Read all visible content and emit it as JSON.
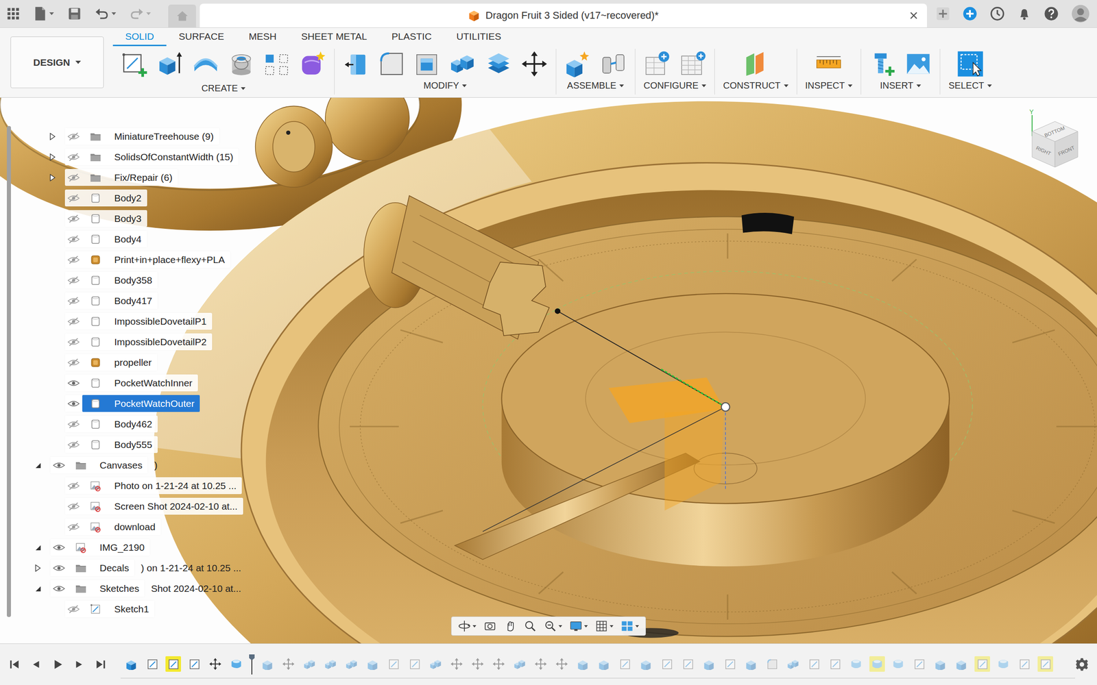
{
  "window": {
    "title": "Dragon Fruit 3 Sided (v17~recovered)*"
  },
  "workspace": {
    "label": "DESIGN"
  },
  "tabs": [
    {
      "label": "SOLID",
      "selected": true
    },
    {
      "label": "SURFACE",
      "selected": false
    },
    {
      "label": "MESH",
      "selected": false
    },
    {
      "label": "SHEET METAL",
      "selected": false
    },
    {
      "label": "PLASTIC",
      "selected": false
    },
    {
      "label": "UTILITIES",
      "selected": false
    }
  ],
  "tool_groups": [
    {
      "label": "CREATE",
      "tools": [
        {
          "kind": "sketch"
        },
        {
          "kind": "extrude"
        },
        {
          "kind": "revolve"
        },
        {
          "kind": "hole"
        },
        {
          "kind": "pattern"
        },
        {
          "kind": "form"
        }
      ]
    },
    {
      "label": "MODIFY",
      "tools": [
        {
          "kind": "presspull"
        },
        {
          "kind": "fillet"
        },
        {
          "kind": "shell"
        },
        {
          "kind": "combine"
        },
        {
          "kind": "offset"
        },
        {
          "kind": "move"
        }
      ]
    },
    {
      "label": "ASSEMBLE",
      "tools": [
        {
          "kind": "component"
        },
        {
          "kind": "joint"
        }
      ]
    },
    {
      "label": "CONFIGURE",
      "tools": [
        {
          "kind": "configure"
        },
        {
          "kind": "table"
        }
      ]
    },
    {
      "label": "CONSTRUCT",
      "tools": [
        {
          "kind": "plane"
        }
      ]
    },
    {
      "label": "INSPECT",
      "tools": [
        {
          "kind": "measure"
        }
      ]
    },
    {
      "label": "INSERT",
      "tools": [
        {
          "kind": "derive"
        },
        {
          "kind": "image"
        }
      ]
    },
    {
      "label": "SELECT",
      "tools": [
        {
          "kind": "select"
        }
      ]
    }
  ],
  "browser": {
    "rows": [
      {
        "label": "MiniatureTreehouse (9)",
        "kind": "folder",
        "depth": 2,
        "expandable": true,
        "expanded": false,
        "visible": false,
        "selected": false,
        "ghost": ""
      },
      {
        "label": "SolidsOfConstantWidth (15)",
        "kind": "folder",
        "depth": 2,
        "expandable": true,
        "expanded": false,
        "visible": false,
        "selected": false,
        "ghost": ""
      },
      {
        "label": "Fix/Repair (6)",
        "kind": "folder",
        "depth": 2,
        "expandable": true,
        "expanded": false,
        "visible": false,
        "selected": false,
        "ghost": ""
      },
      {
        "label": "Body2",
        "kind": "body",
        "depth": 2,
        "expandable": false,
        "expanded": false,
        "visible": false,
        "selected": false,
        "ghost": ""
      },
      {
        "label": "Body3",
        "kind": "body",
        "depth": 2,
        "expandable": false,
        "expanded": false,
        "visible": false,
        "selected": false,
        "ghost": ""
      },
      {
        "label": "Body4",
        "kind": "body",
        "depth": 2,
        "expandable": false,
        "expanded": false,
        "visible": false,
        "selected": false,
        "ghost": ""
      },
      {
        "label": "Print+in+place+flexy+PLA",
        "kind": "component",
        "depth": 2,
        "expandable": false,
        "expanded": false,
        "visible": false,
        "selected": false,
        "ghost": ""
      },
      {
        "label": "Body358",
        "kind": "body",
        "depth": 2,
        "expandable": false,
        "expanded": false,
        "visible": false,
        "selected": false,
        "ghost": ""
      },
      {
        "label": "Body417",
        "kind": "body",
        "depth": 2,
        "expandable": false,
        "expanded": false,
        "visible": false,
        "selected": false,
        "ghost": ""
      },
      {
        "label": "ImpossibleDovetailP1",
        "kind": "body",
        "depth": 2,
        "expandable": false,
        "expanded": false,
        "visible": false,
        "selected": false,
        "ghost": ""
      },
      {
        "label": "ImpossibleDovetailP2",
        "kind": "body",
        "depth": 2,
        "expandable": false,
        "expanded": false,
        "visible": false,
        "selected": false,
        "ghost": ""
      },
      {
        "label": "propeller",
        "kind": "component",
        "depth": 2,
        "expandable": false,
        "expanded": false,
        "visible": false,
        "selected": false,
        "ghost": ""
      },
      {
        "label": "PocketWatchInner",
        "kind": "body",
        "depth": 2,
        "expandable": false,
        "expanded": false,
        "visible": true,
        "selected": false,
        "ghost": ""
      },
      {
        "label": "PocketWatchOuter",
        "kind": "body",
        "depth": 2,
        "expandable": false,
        "expanded": false,
        "visible": true,
        "selected": true,
        "ghost": ""
      },
      {
        "label": "Body462",
        "kind": "body",
        "depth": 2,
        "expandable": false,
        "expanded": false,
        "visible": false,
        "selected": false,
        "ghost": ""
      },
      {
        "label": "Body555",
        "kind": "body",
        "depth": 2,
        "expandable": false,
        "expanded": false,
        "visible": false,
        "selected": false,
        "ghost": ""
      },
      {
        "label": "Canvases",
        "kind": "folder",
        "depth": 1,
        "expandable": true,
        "expanded": true,
        "visible": true,
        "selected": false,
        "ghost": ")"
      },
      {
        "label": "Photo on 1-21-24 at 10.25 ...",
        "kind": "canvas",
        "depth": 2,
        "expandable": false,
        "expanded": false,
        "visible": false,
        "selected": false,
        "ghost": ""
      },
      {
        "label": "Screen Shot 2024-02-10 at...",
        "kind": "canvas",
        "depth": 2,
        "expandable": false,
        "expanded": false,
        "visible": false,
        "selected": false,
        "ghost": ""
      },
      {
        "label": "download",
        "kind": "canvas",
        "depth": 2,
        "expandable": false,
        "expanded": false,
        "visible": false,
        "selected": false,
        "ghost": ""
      },
      {
        "label": "IMG_2190",
        "kind": "canvas",
        "depth": 1,
        "expandable": true,
        "expanded": true,
        "visible": true,
        "selected": false,
        "ghost": ""
      },
      {
        "label": "Decals",
        "kind": "folder",
        "depth": 1,
        "expandable": true,
        "expanded": false,
        "visible": true,
        "selected": false,
        "ghost": ") on 1-21-24 at 10.25 ..."
      },
      {
        "label": "Sketches",
        "kind": "folder",
        "depth": 1,
        "expandable": true,
        "expanded": true,
        "visible": true,
        "selected": false,
        "ghost": "Shot 2024-02-10 at..."
      },
      {
        "label": "Sketch1",
        "kind": "sketch",
        "depth": 2,
        "expandable": false,
        "expanded": false,
        "visible": false,
        "selected": false,
        "ghost": ""
      }
    ]
  },
  "viewcube": {
    "faces": [
      "BOTTOM",
      "FRONT",
      "RIGHT"
    ],
    "axis": "Y"
  },
  "nav_tools": [
    {
      "kind": "orbit",
      "menu": true
    },
    {
      "kind": "look",
      "menu": false
    },
    {
      "kind": "pan",
      "menu": false
    },
    {
      "kind": "zoom",
      "menu": false
    },
    {
      "kind": "zoomwindow",
      "menu": true
    },
    {
      "kind": "display",
      "menu": true
    },
    {
      "kind": "grid",
      "menu": true
    },
    {
      "kind": "viewports",
      "menu": true
    }
  ],
  "timeline": {
    "items": [
      {
        "kind": "body",
        "highlighted": false,
        "active": true
      },
      {
        "kind": "sketch",
        "highlighted": false,
        "active": true
      },
      {
        "kind": "sketch",
        "highlighted": true,
        "active": true
      },
      {
        "kind": "sketch",
        "highlighted": false,
        "active": true
      },
      {
        "kind": "move",
        "highlighted": false,
        "active": true
      },
      {
        "kind": "shell",
        "highlighted": false,
        "active": true
      },
      {
        "kind": "marker",
        "highlighted": false,
        "active": true
      },
      {
        "kind": "body",
        "highlighted": false,
        "active": false
      },
      {
        "kind": "move",
        "highlighted": false,
        "active": false
      },
      {
        "kind": "combine",
        "highlighted": false,
        "active": false
      },
      {
        "kind": "combine",
        "highlighted": false,
        "active": false
      },
      {
        "kind": "combine",
        "highlighted": false,
        "active": false
      },
      {
        "kind": "body",
        "highlighted": false,
        "active": false
      },
      {
        "kind": "sketch",
        "highlighted": false,
        "active": false
      },
      {
        "kind": "sketch",
        "highlighted": false,
        "active": false
      },
      {
        "kind": "combine",
        "highlighted": false,
        "active": false
      },
      {
        "kind": "move",
        "highlighted": false,
        "active": false
      },
      {
        "kind": "move",
        "highlighted": false,
        "active": false
      },
      {
        "kind": "move",
        "highlighted": false,
        "active": false
      },
      {
        "kind": "combine",
        "highlighted": false,
        "active": false
      },
      {
        "kind": "move",
        "highlighted": false,
        "active": false
      },
      {
        "kind": "move",
        "highlighted": false,
        "active": false
      },
      {
        "kind": "body",
        "highlighted": false,
        "active": false
      },
      {
        "kind": "body",
        "highlighted": false,
        "active": false
      },
      {
        "kind": "sketch",
        "highlighted": false,
        "active": false
      },
      {
        "kind": "body",
        "highlighted": false,
        "active": false
      },
      {
        "kind": "sketch",
        "highlighted": false,
        "active": false
      },
      {
        "kind": "sketch",
        "highlighted": false,
        "active": false
      },
      {
        "kind": "body",
        "highlighted": false,
        "active": false
      },
      {
        "kind": "sketch",
        "highlighted": false,
        "active": false
      },
      {
        "kind": "body",
        "highlighted": false,
        "active": false
      },
      {
        "kind": "fillet",
        "highlighted": false,
        "active": false
      },
      {
        "kind": "combine",
        "highlighted": false,
        "active": false
      },
      {
        "kind": "sketch",
        "highlighted": false,
        "active": false
      },
      {
        "kind": "sketch",
        "highlighted": false,
        "active": false
      },
      {
        "kind": "shell",
        "highlighted": false,
        "active": false
      },
      {
        "kind": "shell",
        "highlighted": true,
        "active": false
      },
      {
        "kind": "shell",
        "highlighted": false,
        "active": false
      },
      {
        "kind": "sketch",
        "highlighted": false,
        "active": false
      },
      {
        "kind": "body",
        "highlighted": false,
        "active": false
      },
      {
        "kind": "body",
        "highlighted": false,
        "active": false
      },
      {
        "kind": "sketch",
        "highlighted": true,
        "active": false
      },
      {
        "kind": "shell",
        "highlighted": false,
        "active": false
      },
      {
        "kind": "sketch",
        "highlighted": false,
        "active": false
      },
      {
        "kind": "sketch",
        "highlighted": true,
        "active": false
      }
    ]
  }
}
